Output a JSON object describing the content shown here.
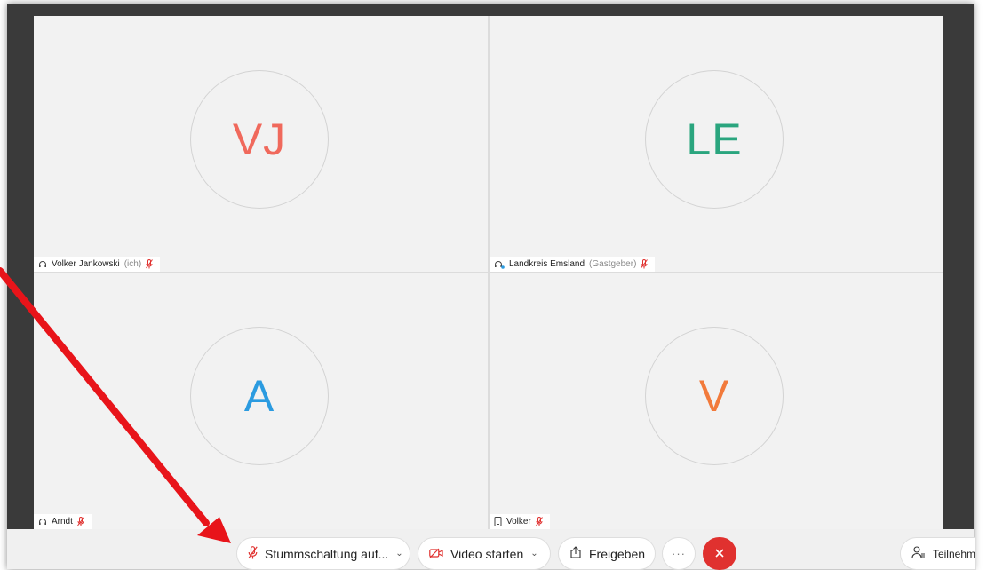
{
  "tiles": [
    {
      "initials": "VJ",
      "initials_color": "#f0695c",
      "name": "Volker Jankowski",
      "sub": "(ich)",
      "device_icon": "headset-icon"
    },
    {
      "initials": "LE",
      "initials_color": "#2aa57e",
      "name": "Landkreis Emsland",
      "sub": "(Gastgeber)",
      "device_icon": "headset-host-icon"
    },
    {
      "initials": "A",
      "initials_color": "#2b9be0",
      "name": "Arndt",
      "sub": "",
      "device_icon": "headset-icon"
    },
    {
      "initials": "V",
      "initials_color": "#f27a3b",
      "name": "Volker",
      "sub": "",
      "device_icon": "phone-icon"
    }
  ],
  "toolbar": {
    "unmute_label": "Stummschaltung auf...",
    "video_label": "Video starten",
    "share_label": "Freigeben",
    "more_label": "···",
    "participants_label": "Teilnehm"
  },
  "colors": {
    "mute_red": "#e0312f",
    "annotation_arrow": "#e8141a"
  }
}
